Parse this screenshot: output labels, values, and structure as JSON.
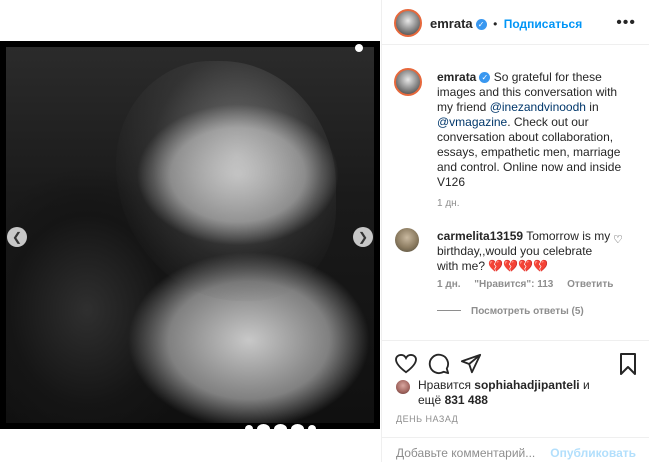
{
  "post": {
    "username": "emrata",
    "follow_label": "Подписаться",
    "separator": "•",
    "caption_lead": "So grateful for these images and this conversation with my friend ",
    "mention1": "@inezandvinoodh",
    "caption_mid": " in ",
    "mention2": "@vmagazine",
    "caption_tail": ". Check out our conversation about collaboration, essays, empathetic men, marriage and control. Online now and inside V126",
    "caption_time": "1 дн."
  },
  "comment": {
    "username": "carmelita13159",
    "text": " Tomorrow is my birthday,,would you celebrate with me? 💔💔💔💔",
    "time": "1 дн.",
    "likes": "\"Нравится\": 113",
    "reply": "Ответить",
    "view_replies": "Посмотреть ответы (5)"
  },
  "likes": {
    "prefix": "Нравится ",
    "user": "sophiahadjipanteli",
    "mid": " и",
    "line2_prefix": "ещё ",
    "count": "831 488"
  },
  "date_label": "ДЕНЬ НАЗАД",
  "comment_box": {
    "placeholder": "Добавьте комментарий...",
    "publish": "Опубликовать"
  },
  "icons": [
    "heart-icon",
    "comment-icon",
    "share-icon",
    "bookmark-icon",
    "more-icon",
    "verified-icon",
    "chevron-left-icon",
    "chevron-right-icon"
  ]
}
